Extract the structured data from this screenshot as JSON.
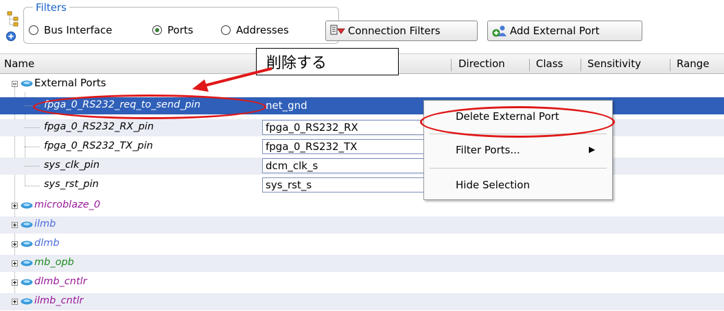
{
  "filters": {
    "legend": "Filters",
    "options": [
      {
        "label": "Bus Interface",
        "selected": false
      },
      {
        "label": "Ports",
        "selected": true
      },
      {
        "label": "Addresses",
        "selected": false
      }
    ],
    "connection_filters_label": "Connection Filters",
    "add_external_port_label": "Add External Port"
  },
  "columns": {
    "name": "Name",
    "direction": "Direction",
    "class": "Class",
    "sensitivity": "Sensitivity",
    "range": "Range"
  },
  "tree": {
    "external_ports": {
      "label": "External Ports",
      "ports": [
        {
          "name": "fpga_0_RS232_req_to_send_pin",
          "net": "net_gnd"
        },
        {
          "name": "fpga_0_RS232_RX_pin",
          "net": "fpga_0_RS232_RX"
        },
        {
          "name": "fpga_0_RS232_TX_pin",
          "net": "fpga_0_RS232_TX"
        },
        {
          "name": "sys_clk_pin",
          "net": "dcm_clk_s"
        },
        {
          "name": "sys_rst_pin",
          "net": "sys_rst_s"
        }
      ]
    },
    "instances": [
      {
        "name": "microblaze_0",
        "color": "#9a1a9a"
      },
      {
        "name": "ilmb",
        "color": "#4a6cd8"
      },
      {
        "name": "dlmb",
        "color": "#4a6cd8"
      },
      {
        "name": "mb_opb",
        "color": "#1f8a1f"
      },
      {
        "name": "dlmb_cntlr",
        "color": "#9a1a9a"
      },
      {
        "name": "ilmb_cntlr",
        "color": "#9a1a9a"
      }
    ]
  },
  "context_menu": {
    "delete_external_port": "Delete External Port",
    "filter_ports": "Filter Ports...",
    "hide_selection": "Hide Selection"
  },
  "annotation": {
    "callout_text": "削除する"
  },
  "colors": {
    "selection": "#2f5fb8",
    "annotation": "#e01818",
    "legend": "#1a64c8"
  }
}
